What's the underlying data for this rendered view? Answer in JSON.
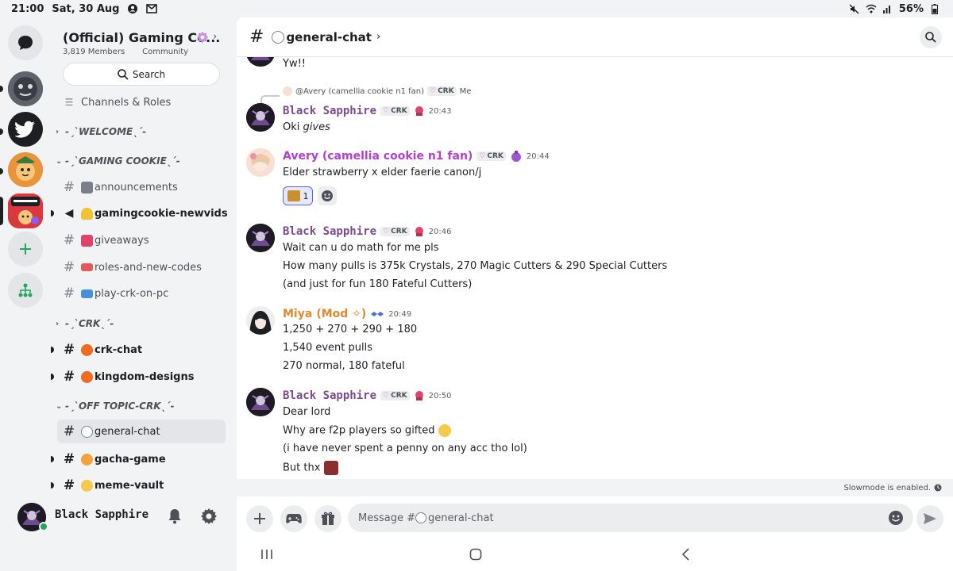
{
  "status_bar": {
    "time": "21:00",
    "date": "Sat, 30 Aug",
    "battery": "56%"
  },
  "server": {
    "name": "(Official) Gaming Co...",
    "members": "3,819 Members",
    "type": "Community",
    "search_label": "Search"
  },
  "sidebar": {
    "channels_roles": "Channels & Roles",
    "categories": {
      "welcome": "-ˏˋWELCOMEˎˊ-",
      "gaming_cookie": "-ˏˋGAMING COOKIEˎˊ-",
      "crk": "-ˏˋCRKˎˊ-",
      "off_topic": "-ˏˋOFF TOPIC-CRKˎˊ-"
    },
    "channels": {
      "announcements": "announcements",
      "newvids": "gamingcookie-newvids",
      "giveaways": "giveaways",
      "roles": "roles-and-new-codes",
      "pc": "play-crk-on-pc",
      "crk_chat": "crk-chat",
      "kingdom": "kingdom-designs",
      "general": "general-chat",
      "gacha": "gacha-game",
      "meme": "meme-vault"
    }
  },
  "user_panel": {
    "name": "Black Sapphire"
  },
  "channel": {
    "name": "general-chat"
  },
  "messages": {
    "m0": {
      "text": "Yw!!"
    },
    "reply": {
      "name": "@Avery (camellia cookie n1 fan)",
      "tag": "CRK",
      "suffix": "Me"
    },
    "m1": {
      "author": "Black Sapphire",
      "tag": "CRK",
      "time": "20:43",
      "text_a": "Oki ",
      "text_b": "gives"
    },
    "m2": {
      "author": "Avery (camellia cookie n1 fan)",
      "tag": "CRK",
      "time": "20:44",
      "text": "Elder strawberry x elder faerie canon/j",
      "reaction_count": "1"
    },
    "m3": {
      "author": "Black Sapphire",
      "tag": "CRK",
      "time": "20:46",
      "lines": [
        "Wait can u do math for me pls",
        "How many pulls is 375k Crystals, 270 Magic Cutters & 290 Special Cutters",
        "(and just for fun 180 Fateful Cutters)"
      ]
    },
    "m4": {
      "author": "Miya",
      "role": "(Mod ✧)",
      "time": "20:49",
      "lines": [
        "1,250 + 270 + 290 + 180",
        "1,540 event pulls",
        "270 normal, 180 fateful"
      ]
    },
    "m5": {
      "author": "Black Sapphire",
      "tag": "CRK",
      "time": "20:50",
      "lines": [
        "Dear lord",
        "Why are f2p players so gifted",
        "(i have never spent a penny on any acc tho lol)",
        "But thx"
      ]
    }
  },
  "slowmode": "Slowmode is enabled.",
  "composer": {
    "placeholder": "Message #",
    "channel": "general-chat"
  },
  "colors": {
    "sapphire": "#7b4a8f",
    "avery": "#b33fcf",
    "miya": "#e0892e",
    "online": "#23a55a",
    "accent": "#5865f2"
  }
}
